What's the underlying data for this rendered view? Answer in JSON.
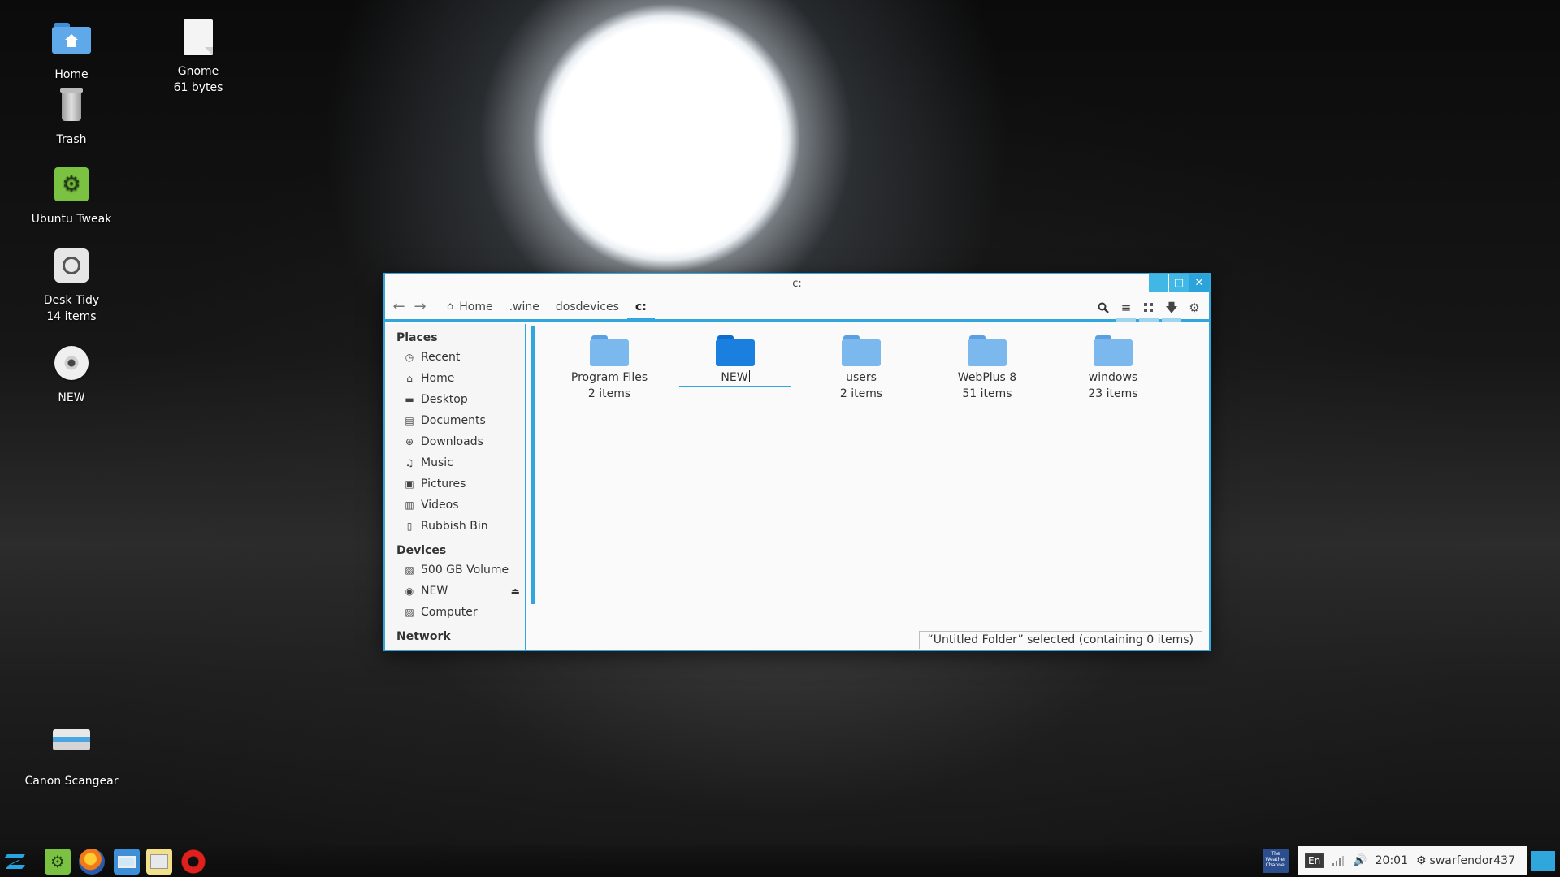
{
  "desktop": {
    "icons": [
      {
        "id": "home",
        "label": "Home",
        "sub": ""
      },
      {
        "id": "gnome",
        "label": "Gnome",
        "sub": "61 bytes"
      },
      {
        "id": "trash",
        "label": "Trash",
        "sub": ""
      },
      {
        "id": "ubuntu-tweak",
        "label": "Ubuntu Tweak",
        "sub": ""
      },
      {
        "id": "desk-tidy",
        "label": "Desk Tidy",
        "sub": "14 items"
      },
      {
        "id": "new-disc",
        "label": "NEW",
        "sub": ""
      },
      {
        "id": "canon",
        "label": "Canon Scangear",
        "sub": ""
      }
    ]
  },
  "window": {
    "title": "c:",
    "controls": {
      "minimize": "–",
      "maximize": "□",
      "close": "✕"
    },
    "breadcrumbs": [
      "Home",
      ".wine",
      "dosdevices",
      "c:"
    ],
    "sidebar": {
      "places_header": "Places",
      "places": [
        {
          "label": "Recent",
          "icon": "clock-icon"
        },
        {
          "label": "Home",
          "icon": "home-icon"
        },
        {
          "label": "Desktop",
          "icon": "desktop-folder-icon"
        },
        {
          "label": "Documents",
          "icon": "document-icon"
        },
        {
          "label": "Downloads",
          "icon": "download-icon"
        },
        {
          "label": "Music",
          "icon": "music-note-icon"
        },
        {
          "label": "Pictures",
          "icon": "pictures-icon"
        },
        {
          "label": "Videos",
          "icon": "film-icon"
        },
        {
          "label": "Rubbish Bin",
          "icon": "trash-icon"
        }
      ],
      "devices_header": "Devices",
      "devices": [
        {
          "label": "500 GB Volume",
          "icon": "drive-icon"
        },
        {
          "label": "NEW",
          "icon": "disc-icon"
        },
        {
          "label": "Computer",
          "icon": "computer-icon"
        }
      ],
      "network_header": "Network"
    },
    "files": [
      {
        "name": "Program Files",
        "info": "2 items"
      },
      {
        "name": "NEW",
        "info": "",
        "renaming": true
      },
      {
        "name": "users",
        "info": "2 items"
      },
      {
        "name": "WebPlus 8",
        "info": "51 items"
      },
      {
        "name": "windows",
        "info": "23 items"
      }
    ],
    "status": "“Untitled Folder” selected  (containing 0 items)"
  },
  "taskbar": {
    "language": "En",
    "time": "20:01",
    "user": "swarfendor437",
    "weather_label": "The Weather Channel"
  },
  "colors": {
    "accent": "#2fa7dc",
    "folder": "#6fb3ea",
    "folder_selected": "#1b7fe0"
  }
}
